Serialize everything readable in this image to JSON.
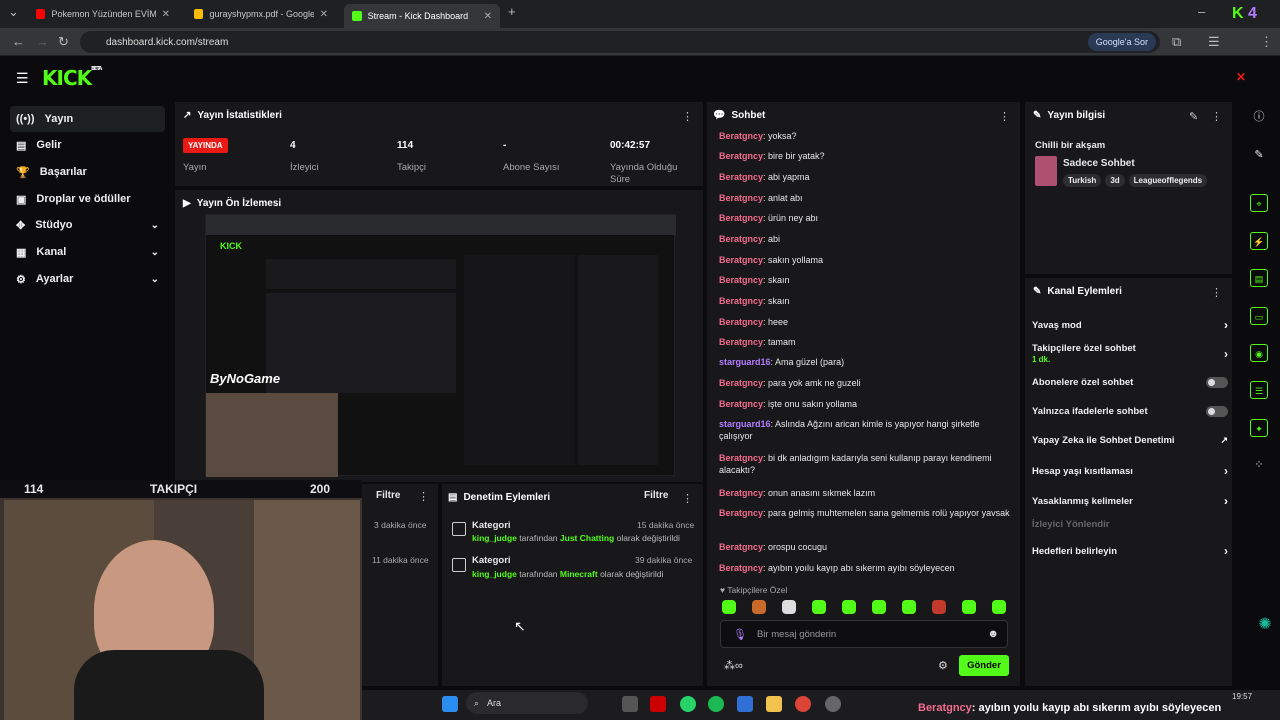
{
  "browser": {
    "tabs": [
      {
        "title": "Pokemon Yüzünden EVİMİ POL"
      },
      {
        "title": "gurayshypmx.pdf - Google Driv"
      },
      {
        "title": "Stream - Kick Dashboard"
      }
    ],
    "url": "dashboard.kick.com/stream",
    "google_btn": "Google'a Sor"
  },
  "sidebar": {
    "items": [
      {
        "label": "Yayın"
      },
      {
        "label": "Gelir"
      },
      {
        "label": "Başarılar"
      },
      {
        "label": "Droplar ve ödüller"
      },
      {
        "label": "Stüdyo"
      },
      {
        "label": "Kanal"
      },
      {
        "label": "Ayarlar"
      }
    ]
  },
  "stats": {
    "title": "Yayın İstatistikleri",
    "live_badge": "YAYINDA",
    "live_label": "Yayın",
    "viewers_value": "4",
    "viewers_label": "İzleyici",
    "followers_value": "114",
    "followers_label": "Takipçi",
    "subs_value": "-",
    "subs_label": "Abone Sayısı",
    "uptime_value": "00:42:57",
    "uptime_label": "Yayında Olduğu Süre"
  },
  "preview": {
    "title": "Yayın Ön İzlemesi",
    "watermark": "ByNoGame"
  },
  "overlay": {
    "count_left": "114",
    "label": "TAKIPÇI",
    "count_right": "200"
  },
  "events_left": {
    "filter": "Filtre",
    "times": [
      "3 dakika önce",
      "11 dakika önce"
    ]
  },
  "moderation": {
    "title": "Denetim Eylemleri",
    "filter": "Filtre",
    "items": [
      {
        "title": "Kategori",
        "time": "15 dakika önce",
        "user": "king_judge",
        "mid": "tarafından",
        "target": "Just Chatting",
        "tail": "olarak değiştirildi"
      },
      {
        "title": "Kategori",
        "time": "39 dakika önce",
        "user": "king_judge",
        "mid": "tarafından",
        "target": "Minecraft",
        "tail": "olarak değiştirildi"
      }
    ]
  },
  "chat": {
    "title": "Sohbet",
    "messages": [
      {
        "user": "Beratgncy",
        "text": ": yoksa?"
      },
      {
        "user": "Beratgncy",
        "text": ": bire bir yatak?"
      },
      {
        "user": "Beratgncy",
        "text": ": abi yapma"
      },
      {
        "user": "Beratgncy",
        "text": ": anlat abı"
      },
      {
        "user": "Beratgncy",
        "text": ": ürün ney abı"
      },
      {
        "user": "Beratgncy",
        "text": ": abi"
      },
      {
        "user": "Beratgncy",
        "text": ": sakın yollama"
      },
      {
        "user": "Beratgncy",
        "text": ": skaın"
      },
      {
        "user": "Beratgncy",
        "text": ": skaın"
      },
      {
        "user": "Beratgncy",
        "text": ": heee"
      },
      {
        "user": "Beratgncy",
        "text": ": tamam"
      },
      {
        "user": "starguard16",
        "text": ": Ama güzel (para)"
      },
      {
        "user": "Beratgncy",
        "text": ": para yok amk ne guzeli"
      },
      {
        "user": "Beratgncy",
        "text": ": işte onu sakın yollama"
      },
      {
        "user": "starguard16",
        "text": ": Aslında Ağzını arican kimle is yapıyor hangi şirketle çalışıyor"
      },
      {
        "user": "Beratgncy",
        "text": ": bi dk anladıgım kadarıyla seni kullanıp parayı kendinemi alacaktı?"
      },
      {
        "user": "Beratgncy",
        "text": ": onun anasını sıkmek lazım"
      },
      {
        "user": "Beratgncy",
        "text": ": para gelmiş muhtemelen sana gelmemis rolü yapıyor yavsak"
      },
      {
        "user": "Beratgncy",
        "text": ": orospu cocugu"
      },
      {
        "user": "Beratgncy",
        "text": ": ayıbın yoılu kayıp abı sıkerım ayıbı söyleyecen"
      }
    ],
    "followers_only": "Takipçilere Özel",
    "placeholder": "Bir mesaj gönderin",
    "send": "Gönder",
    "user_color": "#f36b8f",
    "user2_color": "#b37cff"
  },
  "info": {
    "title": "Yayın bilgisi",
    "stream_title": "Chilli bir akşam",
    "category": "Sadece Sohbet",
    "tags": [
      "Turkish",
      "3d",
      "Leagueofflegends"
    ]
  },
  "channel": {
    "title": "Kanal Eylemleri",
    "items": [
      {
        "label": "Yavaş mod"
      },
      {
        "label": "Takipçilere özel sohbet",
        "sub": "1 dk."
      },
      {
        "label": "Abonelere özel sohbet"
      },
      {
        "label": "Yalnızca ifadelerle sohbet"
      },
      {
        "label": "Yapay Zeka ile Sohbet Denetimi"
      },
      {
        "label": "Hesap yaşı kısıtlaması"
      },
      {
        "label": "Yasaklanmış kelimeler"
      },
      {
        "label": "İzleyici Yönlendir"
      },
      {
        "label": "Hedefleri belirleyin"
      }
    ]
  },
  "taskbar": {
    "search": "Ara",
    "time": "19:57",
    "ticker_user": "Beratgncy",
    "ticker_text": ": ayıbın yoılu kayıp abı sıkerım ayıbı söyleyecen"
  },
  "colors": {
    "accent": "#53fc18",
    "live": "#e91916",
    "panel": "#18181b"
  }
}
